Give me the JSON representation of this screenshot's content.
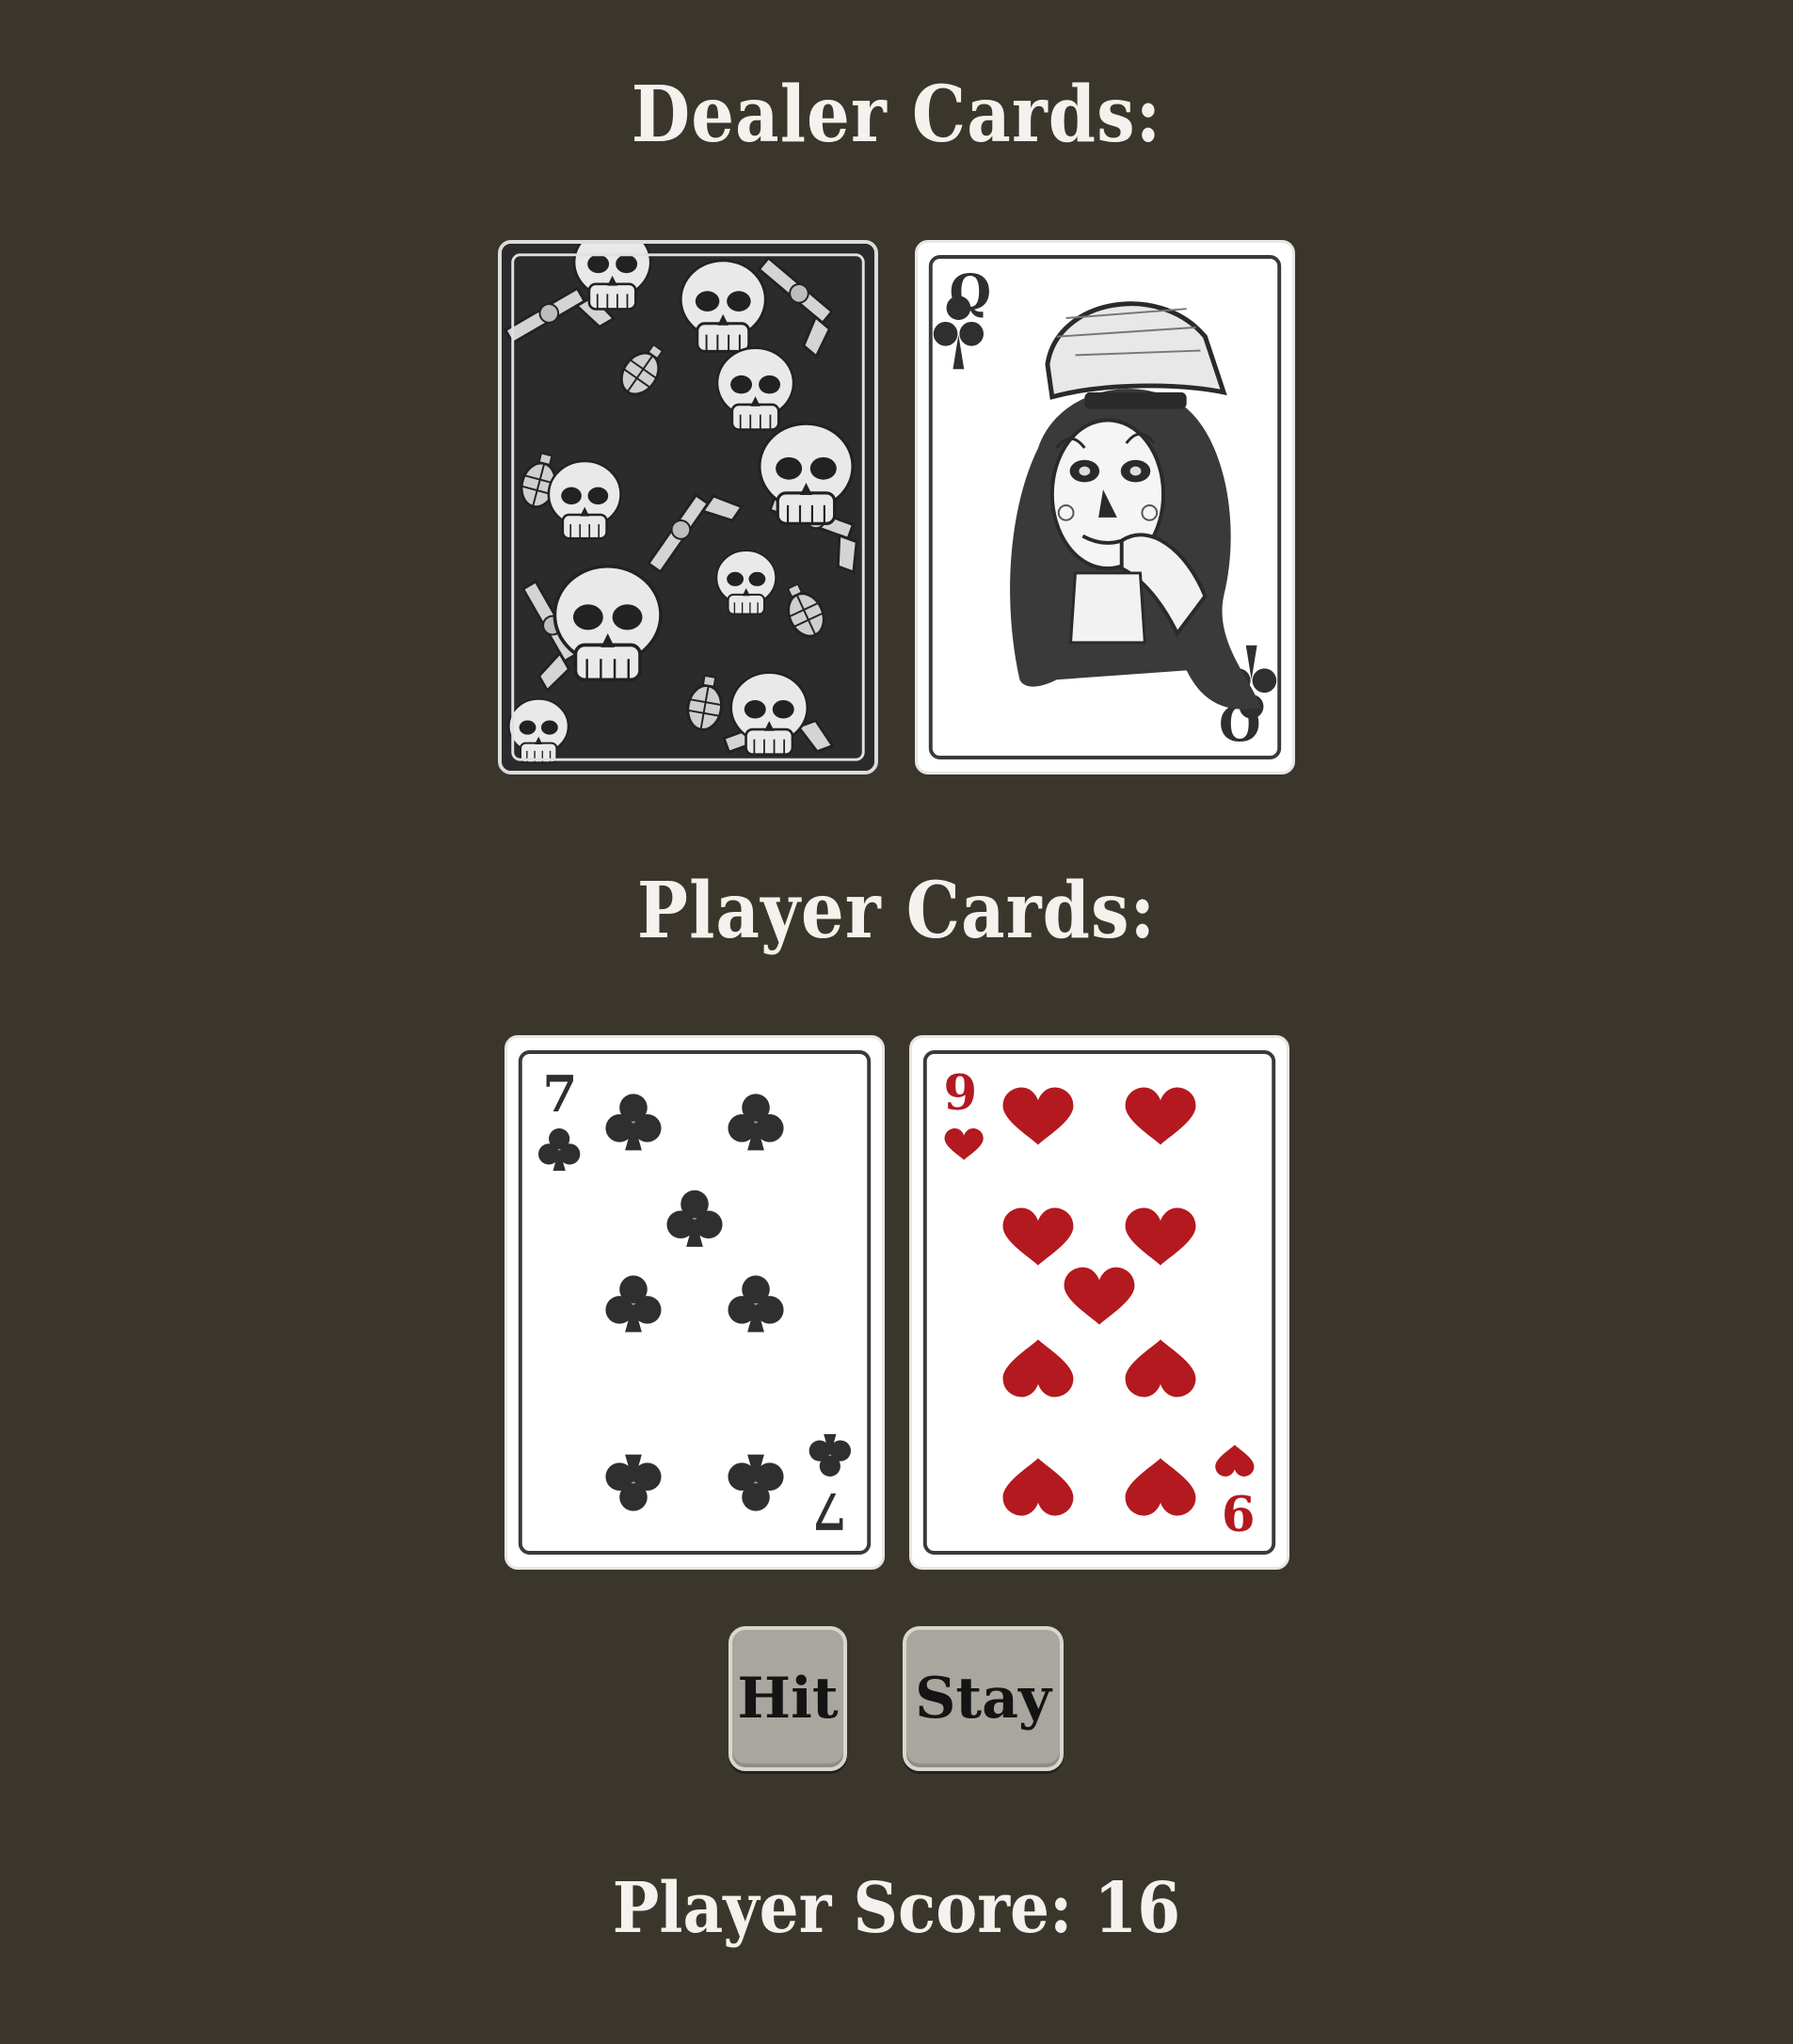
{
  "dealer": {
    "heading": "Dealer Cards:",
    "cards": [
      {
        "face": "down",
        "back": "skull-pattern"
      },
      {
        "face": "up",
        "rank": "Q",
        "suit": "clubs",
        "suit_icon": "club-icon",
        "color": "#2f2f2f"
      }
    ]
  },
  "player": {
    "heading": "Player Cards:",
    "cards": [
      {
        "face": "up",
        "rank": "7",
        "suit": "clubs",
        "suit_icon": "club-icon",
        "color": "#2f2f2f"
      },
      {
        "face": "up",
        "rank": "9",
        "suit": "hearts",
        "suit_icon": "heart-icon",
        "color": "#b3191f"
      }
    ]
  },
  "controls": {
    "hit_label": "Hit",
    "stay_label": "Stay"
  },
  "score": {
    "label": "Player Score: 16"
  },
  "colors": {
    "background": "#3b362c",
    "text": "#f4f2ee",
    "button": "#a8a69e",
    "red_suit": "#b3191f",
    "black_suit": "#2f2f2f"
  }
}
